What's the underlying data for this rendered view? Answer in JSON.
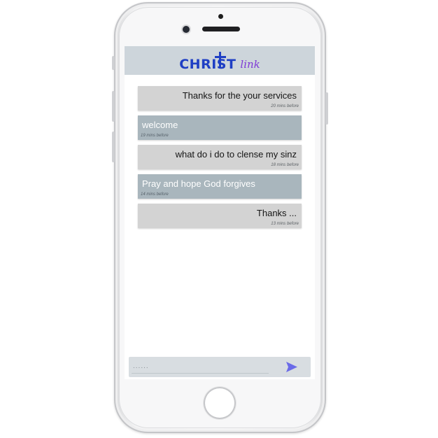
{
  "app": {
    "logo_text": "CHRIST",
    "logo_script": "link"
  },
  "messages": [
    {
      "side": "sent",
      "text": "Thanks for the your services",
      "time": "20 mins before"
    },
    {
      "side": "recv",
      "text": "welcome",
      "time": "19 mins before"
    },
    {
      "side": "sent",
      "text": "what do i do to clense my sinz",
      "time": "18 mins before"
    },
    {
      "side": "recv",
      "text": "Pray and hope God forgives",
      "time": "14 mins before"
    },
    {
      "side": "sent",
      "text": "Thanks ...",
      "time": "13 mins before"
    }
  ],
  "composer": {
    "placeholder": "......",
    "value": "",
    "send_icon": "send-icon"
  },
  "colors": {
    "header_bg": "#cdd5db",
    "logo_blue": "#1f3fc4",
    "logo_purple": "#7f3ad6",
    "sent_bubble": "#d3d3d3",
    "received_bubble": "#a9b6bd",
    "send_icon": "#6b6be8"
  }
}
